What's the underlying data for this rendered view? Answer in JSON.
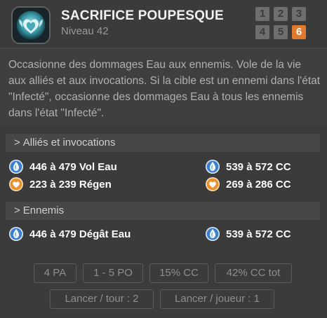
{
  "spell": {
    "title": "SACRIFICE POUPESQUE",
    "level_label": "Niveau 42",
    "icon": "heart-wings-spell-icon",
    "levels": [
      "1",
      "2",
      "3",
      "4",
      "5",
      "6"
    ],
    "active_level": "6",
    "description": "Occasionne des dommages Eau aux ennemis. Vole de la vie aux alliés et aux invocations. Si la cible est un ennemi dans l'état \"Infecté\", occasionne des dommages Eau à tous les ennemis dans l'état \"Infecté\"."
  },
  "sections": {
    "allies": {
      "header": "Alliés et invocations",
      "effects": [
        {
          "text": "446 à 479 Vol Eau",
          "icon": "water-drop-icon"
        },
        {
          "text": "223 à 239 Régen",
          "icon": "heal-heart-icon"
        }
      ],
      "critical": [
        {
          "text": "539 à 572 CC",
          "icon": "water-drop-icon"
        },
        {
          "text": "269 à 286 CC",
          "icon": "heal-heart-icon"
        }
      ]
    },
    "enemies": {
      "header": "Ennemis",
      "effects": [
        {
          "text": "446 à 479 Dégât Eau",
          "icon": "water-drop-icon"
        }
      ],
      "critical": [
        {
          "text": "539 à 572 CC",
          "icon": "water-drop-icon"
        }
      ]
    }
  },
  "stats": {
    "pa": "4 PA",
    "po": "1 - 5 PO",
    "cc": "15% CC",
    "cc_tot": "42% CC tot",
    "per_turn": "Lancer / tour : 2",
    "per_player": "Lancer / joueur : 1"
  },
  "colors": {
    "accent_active_level": "#e07a2d",
    "water": "#3a7fd1",
    "heal": "#e8912e",
    "panel_bg": "#3b3b3b"
  }
}
